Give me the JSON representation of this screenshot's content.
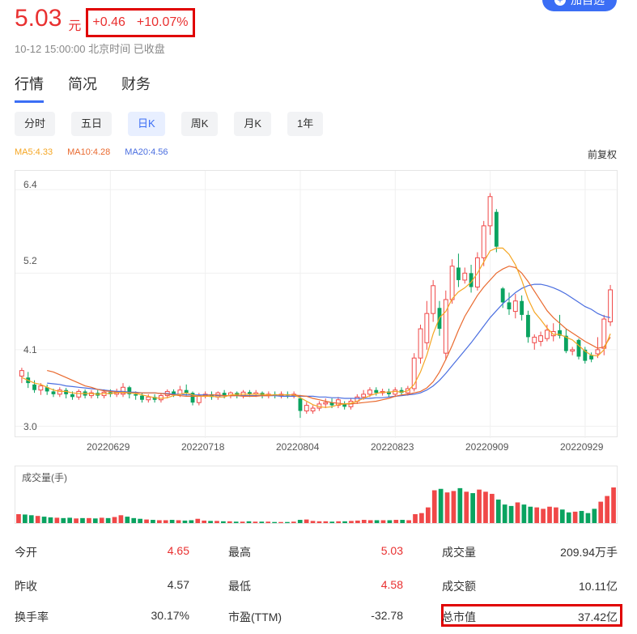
{
  "header": {
    "price": "5.03",
    "unit": "元",
    "change": "+0.46",
    "change_pct": "+10.07%",
    "timestamp": "10-12 15:00:00 北京时间 已收盘",
    "add_button": "加自选"
  },
  "tabs": [
    {
      "label": "行情",
      "active": true
    },
    {
      "label": "简况",
      "active": false
    },
    {
      "label": "财务",
      "active": false
    }
  ],
  "periods": [
    {
      "label": "分时",
      "active": false
    },
    {
      "label": "五日",
      "active": false
    },
    {
      "label": "日K",
      "active": true
    },
    {
      "label": "周K",
      "active": false
    },
    {
      "label": "月K",
      "active": false
    },
    {
      "label": "1年",
      "active": false
    }
  ],
  "ma": {
    "ma5": "MA5:4.33",
    "ma10": "MA10:4.28",
    "ma20": "MA20:4.56"
  },
  "adjust_label": "前复权",
  "colors": {
    "up": "#f04848",
    "down": "#0aa360",
    "accent": "#3b6ef5",
    "ma5": "#f5a623",
    "ma10": "#e96a2f",
    "ma20": "#4a6ee0"
  },
  "chart_data": {
    "type": "candlestick",
    "y_ticks": [
      "6.4",
      "5.2",
      "4.1",
      "3.0"
    ],
    "ylim": [
      2.9,
      6.6
    ],
    "x_ticks": [
      "20220629",
      "20220718",
      "20220804",
      "20220823",
      "20220909",
      "20220929"
    ],
    "candles": [
      [
        3.72,
        3.8,
        3.62,
        3.84
      ],
      [
        3.7,
        3.62,
        3.55,
        3.78
      ],
      [
        3.6,
        3.52,
        3.48,
        3.66
      ],
      [
        3.52,
        3.58,
        3.45,
        3.62
      ],
      [
        3.56,
        3.5,
        3.45,
        3.6
      ],
      [
        3.5,
        3.46,
        3.42,
        3.54
      ],
      [
        3.46,
        3.52,
        3.42,
        3.56
      ],
      [
        3.52,
        3.46,
        3.4,
        3.55
      ],
      [
        3.46,
        3.42,
        3.38,
        3.5
      ],
      [
        3.42,
        3.5,
        3.38,
        3.53
      ],
      [
        3.5,
        3.44,
        3.4,
        3.53
      ],
      [
        3.44,
        3.48,
        3.4,
        3.52
      ],
      [
        3.48,
        3.44,
        3.4,
        3.52
      ],
      [
        3.44,
        3.49,
        3.4,
        3.53
      ],
      [
        3.49,
        3.46,
        3.42,
        3.53
      ],
      [
        3.46,
        3.5,
        3.42,
        3.54
      ],
      [
        3.46,
        3.56,
        3.42,
        3.62
      ],
      [
        3.56,
        3.46,
        3.4,
        3.58
      ],
      [
        3.46,
        3.44,
        3.38,
        3.5
      ],
      [
        3.44,
        3.38,
        3.34,
        3.48
      ],
      [
        3.38,
        3.42,
        3.34,
        3.46
      ],
      [
        3.42,
        3.38,
        3.34,
        3.46
      ],
      [
        3.38,
        3.44,
        3.34,
        3.48
      ],
      [
        3.44,
        3.5,
        3.4,
        3.53
      ],
      [
        3.5,
        3.46,
        3.42,
        3.53
      ],
      [
        3.46,
        3.52,
        3.42,
        3.58
      ],
      [
        3.52,
        3.48,
        3.44,
        3.6
      ],
      [
        3.48,
        3.34,
        3.3,
        3.5
      ],
      [
        3.34,
        3.44,
        3.3,
        3.48
      ],
      [
        3.44,
        3.46,
        3.4,
        3.5
      ],
      [
        3.46,
        3.42,
        3.38,
        3.5
      ],
      [
        3.42,
        3.48,
        3.38,
        3.5
      ],
      [
        3.48,
        3.44,
        3.4,
        3.52
      ],
      [
        3.44,
        3.48,
        3.4,
        3.5
      ],
      [
        3.48,
        3.44,
        3.4,
        3.5
      ],
      [
        3.44,
        3.49,
        3.4,
        3.52
      ],
      [
        3.49,
        3.46,
        3.42,
        3.52
      ],
      [
        3.46,
        3.48,
        3.42,
        3.52
      ],
      [
        3.48,
        3.44,
        3.4,
        3.5
      ],
      [
        3.44,
        3.46,
        3.4,
        3.5
      ],
      [
        3.46,
        3.44,
        3.4,
        3.5
      ],
      [
        3.44,
        3.46,
        3.4,
        3.5
      ],
      [
        3.46,
        3.44,
        3.4,
        3.5
      ],
      [
        3.44,
        3.46,
        3.4,
        3.5
      ],
      [
        3.4,
        3.22,
        3.12,
        3.45
      ],
      [
        3.22,
        3.3,
        3.18,
        3.35
      ],
      [
        3.22,
        3.26,
        3.18,
        3.3
      ],
      [
        3.26,
        3.32,
        3.22,
        3.36
      ],
      [
        3.32,
        3.34,
        3.26,
        3.4
      ],
      [
        3.34,
        3.3,
        3.26,
        3.4
      ],
      [
        3.3,
        3.38,
        3.26,
        3.42
      ],
      [
        3.32,
        3.28,
        3.24,
        3.36
      ],
      [
        3.28,
        3.36,
        3.24,
        3.4
      ],
      [
        3.36,
        3.42,
        3.32,
        3.46
      ],
      [
        3.42,
        3.46,
        3.38,
        3.52
      ],
      [
        3.46,
        3.52,
        3.42,
        3.56
      ],
      [
        3.52,
        3.48,
        3.44,
        3.56
      ],
      [
        3.48,
        3.5,
        3.44,
        3.54
      ],
      [
        3.5,
        3.46,
        3.42,
        3.54
      ],
      [
        3.46,
        3.52,
        3.42,
        3.56
      ],
      [
        3.52,
        3.48,
        3.44,
        3.56
      ],
      [
        3.48,
        3.54,
        3.44,
        3.58
      ],
      [
        3.54,
        3.98,
        3.5,
        4.05
      ],
      [
        3.98,
        4.4,
        3.9,
        4.46
      ],
      [
        4.2,
        4.62,
        4.1,
        4.8
      ],
      [
        4.62,
        5.02,
        4.5,
        5.1
      ],
      [
        4.7,
        4.4,
        4.3,
        4.8
      ],
      [
        4.05,
        4.82,
        3.95,
        4.95
      ],
      [
        4.82,
        5.3,
        4.76,
        5.4
      ],
      [
        5.28,
        5.1,
        5.0,
        5.48
      ],
      [
        5.1,
        5.2,
        5.05,
        5.28
      ],
      [
        5.2,
        5.0,
        4.92,
        5.32
      ],
      [
        5.0,
        5.42,
        4.95,
        5.5
      ],
      [
        5.42,
        5.88,
        5.3,
        5.95
      ],
      [
        5.88,
        6.3,
        5.75,
        6.35
      ],
      [
        6.08,
        5.58,
        5.5,
        6.12
      ],
      [
        4.98,
        4.78,
        4.7,
        5.0
      ],
      [
        4.78,
        4.68,
        4.6,
        4.92
      ],
      [
        4.65,
        4.8,
        4.55,
        4.9
      ],
      [
        4.8,
        4.6,
        4.52,
        4.88
      ],
      [
        4.6,
        4.28,
        4.2,
        4.66
      ],
      [
        4.2,
        4.28,
        4.1,
        4.32
      ],
      [
        4.22,
        4.3,
        4.15,
        4.36
      ],
      [
        4.26,
        4.38,
        4.22,
        4.46
      ],
      [
        4.3,
        4.36,
        4.22,
        4.48
      ],
      [
        4.38,
        4.3,
        4.26,
        4.6
      ],
      [
        4.3,
        4.08,
        4.05,
        4.4
      ],
      [
        4.08,
        4.1,
        4.02,
        4.14
      ],
      [
        4.24,
        4.0,
        3.96,
        4.26
      ],
      [
        4.1,
        3.94,
        3.9,
        4.14
      ],
      [
        4.02,
        3.96,
        3.92,
        4.06
      ],
      [
        4.04,
        4.1,
        3.98,
        4.28
      ],
      [
        4.12,
        4.54,
        4.02,
        4.6
      ],
      [
        4.5,
        4.96,
        4.44,
        5.03
      ]
    ],
    "ma5": [
      3.7,
      3.66,
      3.62,
      3.6,
      3.56,
      3.52,
      3.5,
      3.5,
      3.48,
      3.47,
      3.47,
      3.47,
      3.46,
      3.47,
      3.47,
      3.48,
      3.49,
      3.48,
      3.47,
      3.45,
      3.43,
      3.41,
      3.4,
      3.41,
      3.44,
      3.46,
      3.48,
      3.45,
      3.43,
      3.43,
      3.43,
      3.42,
      3.42,
      3.45,
      3.46,
      3.46,
      3.46,
      3.46,
      3.46,
      3.45,
      3.45,
      3.45,
      3.45,
      3.45,
      3.41,
      3.36,
      3.31,
      3.28,
      3.27,
      3.28,
      3.31,
      3.32,
      3.33,
      3.36,
      3.4,
      3.44,
      3.47,
      3.49,
      3.49,
      3.5,
      3.49,
      3.51,
      3.6,
      3.78,
      4.02,
      4.33,
      4.56,
      4.65,
      4.83,
      4.93,
      4.99,
      5.07,
      5.2,
      5.36,
      5.52,
      5.56,
      5.56,
      5.47,
      5.32,
      5.1,
      4.83,
      4.64,
      4.53,
      4.41,
      4.32,
      4.32,
      4.28,
      4.24,
      4.16,
      4.08,
      4.02,
      4.01,
      4.1,
      4.33
    ],
    "ma10": [
      3.8,
      3.78,
      3.74,
      3.7,
      3.66,
      3.62,
      3.58,
      3.56,
      3.53,
      3.51,
      3.5,
      3.49,
      3.48,
      3.48,
      3.48,
      3.48,
      3.48,
      3.48,
      3.47,
      3.46,
      3.45,
      3.44,
      3.43,
      3.43,
      3.43,
      3.44,
      3.45,
      3.45,
      3.44,
      3.44,
      3.44,
      3.43,
      3.43,
      3.43,
      3.44,
      3.44,
      3.45,
      3.45,
      3.45,
      3.45,
      3.44,
      3.43,
      3.4,
      3.38,
      3.36,
      3.34,
      3.33,
      3.32,
      3.32,
      3.33,
      3.34,
      3.35,
      3.36,
      3.38,
      3.4,
      3.43,
      3.45,
      3.46,
      3.48,
      3.5,
      3.55,
      3.64,
      3.78,
      3.96,
      4.16,
      4.38,
      4.58,
      4.73,
      4.88,
      5.0,
      5.1,
      5.2,
      5.26,
      5.3,
      5.28,
      5.2,
      5.08,
      4.94,
      4.8,
      4.66,
      4.56,
      4.48,
      4.4,
      4.34,
      4.28,
      4.22,
      4.17,
      4.12,
      4.14,
      4.28
    ],
    "ma20": [
      3.62,
      3.61,
      3.6,
      3.58,
      3.57,
      3.56,
      3.55,
      3.54,
      3.53,
      3.52,
      3.51,
      3.5,
      3.5,
      3.49,
      3.49,
      3.48,
      3.48,
      3.48,
      3.47,
      3.47,
      3.46,
      3.46,
      3.45,
      3.45,
      3.45,
      3.45,
      3.45,
      3.44,
      3.44,
      3.44,
      3.44,
      3.44,
      3.44,
      3.44,
      3.44,
      3.44,
      3.44,
      3.43,
      3.43,
      3.43,
      3.43,
      3.43,
      3.43,
      3.42,
      3.42,
      3.41,
      3.41,
      3.4,
      3.4,
      3.4,
      3.4,
      3.4,
      3.41,
      3.41,
      3.42,
      3.43,
      3.44,
      3.45,
      3.46,
      3.48,
      3.52,
      3.58,
      3.66,
      3.76,
      3.87,
      3.98,
      4.09,
      4.2,
      4.32,
      4.44,
      4.56,
      4.66,
      4.76,
      4.84,
      4.92,
      4.98,
      5.02,
      5.04,
      5.04,
      5.02,
      4.99,
      4.95,
      4.9,
      4.84,
      4.78,
      4.72,
      4.68,
      4.62,
      4.58,
      4.56
    ]
  },
  "volume_label": "成交量(手)",
  "volume": {
    "max": 100,
    "bars": [
      25,
      24,
      22,
      20,
      18,
      16,
      15,
      14,
      15,
      13,
      14,
      14,
      13,
      15,
      14,
      17,
      22,
      18,
      14,
      12,
      10,
      9,
      8,
      8,
      9,
      8,
      7,
      8,
      12,
      7,
      6,
      6,
      5,
      5,
      4,
      4,
      5,
      4,
      4,
      4,
      3,
      3,
      3,
      4,
      9,
      10,
      6,
      5,
      5,
      4,
      5,
      5,
      6,
      7,
      9,
      8,
      8,
      8,
      8,
      9,
      9,
      8,
      25,
      28,
      44,
      92,
      96,
      86,
      90,
      98,
      88,
      84,
      94,
      88,
      82,
      66,
      52,
      48,
      58,
      52,
      46,
      44,
      40,
      46,
      44,
      38,
      30,
      32,
      34,
      28,
      40,
      60,
      76,
      100
    ]
  },
  "stats": [
    [
      {
        "label": "今开",
        "value": "4.65",
        "red": true
      },
      {
        "label": "最高",
        "value": "5.03",
        "red": true
      },
      {
        "label": "成交量",
        "value": "209.94万手",
        "red": false
      }
    ],
    [
      {
        "label": "昨收",
        "value": "4.57",
        "red": false
      },
      {
        "label": "最低",
        "value": "4.58",
        "red": true
      },
      {
        "label": "成交额",
        "value": "10.11亿",
        "red": false
      }
    ],
    [
      {
        "label": "换手率",
        "value": "30.17%",
        "red": false
      },
      {
        "label": "市盈(TTM)",
        "value": "-32.78",
        "red": false
      },
      {
        "label": "总市值",
        "value": "37.42亿",
        "red": false
      }
    ]
  ]
}
